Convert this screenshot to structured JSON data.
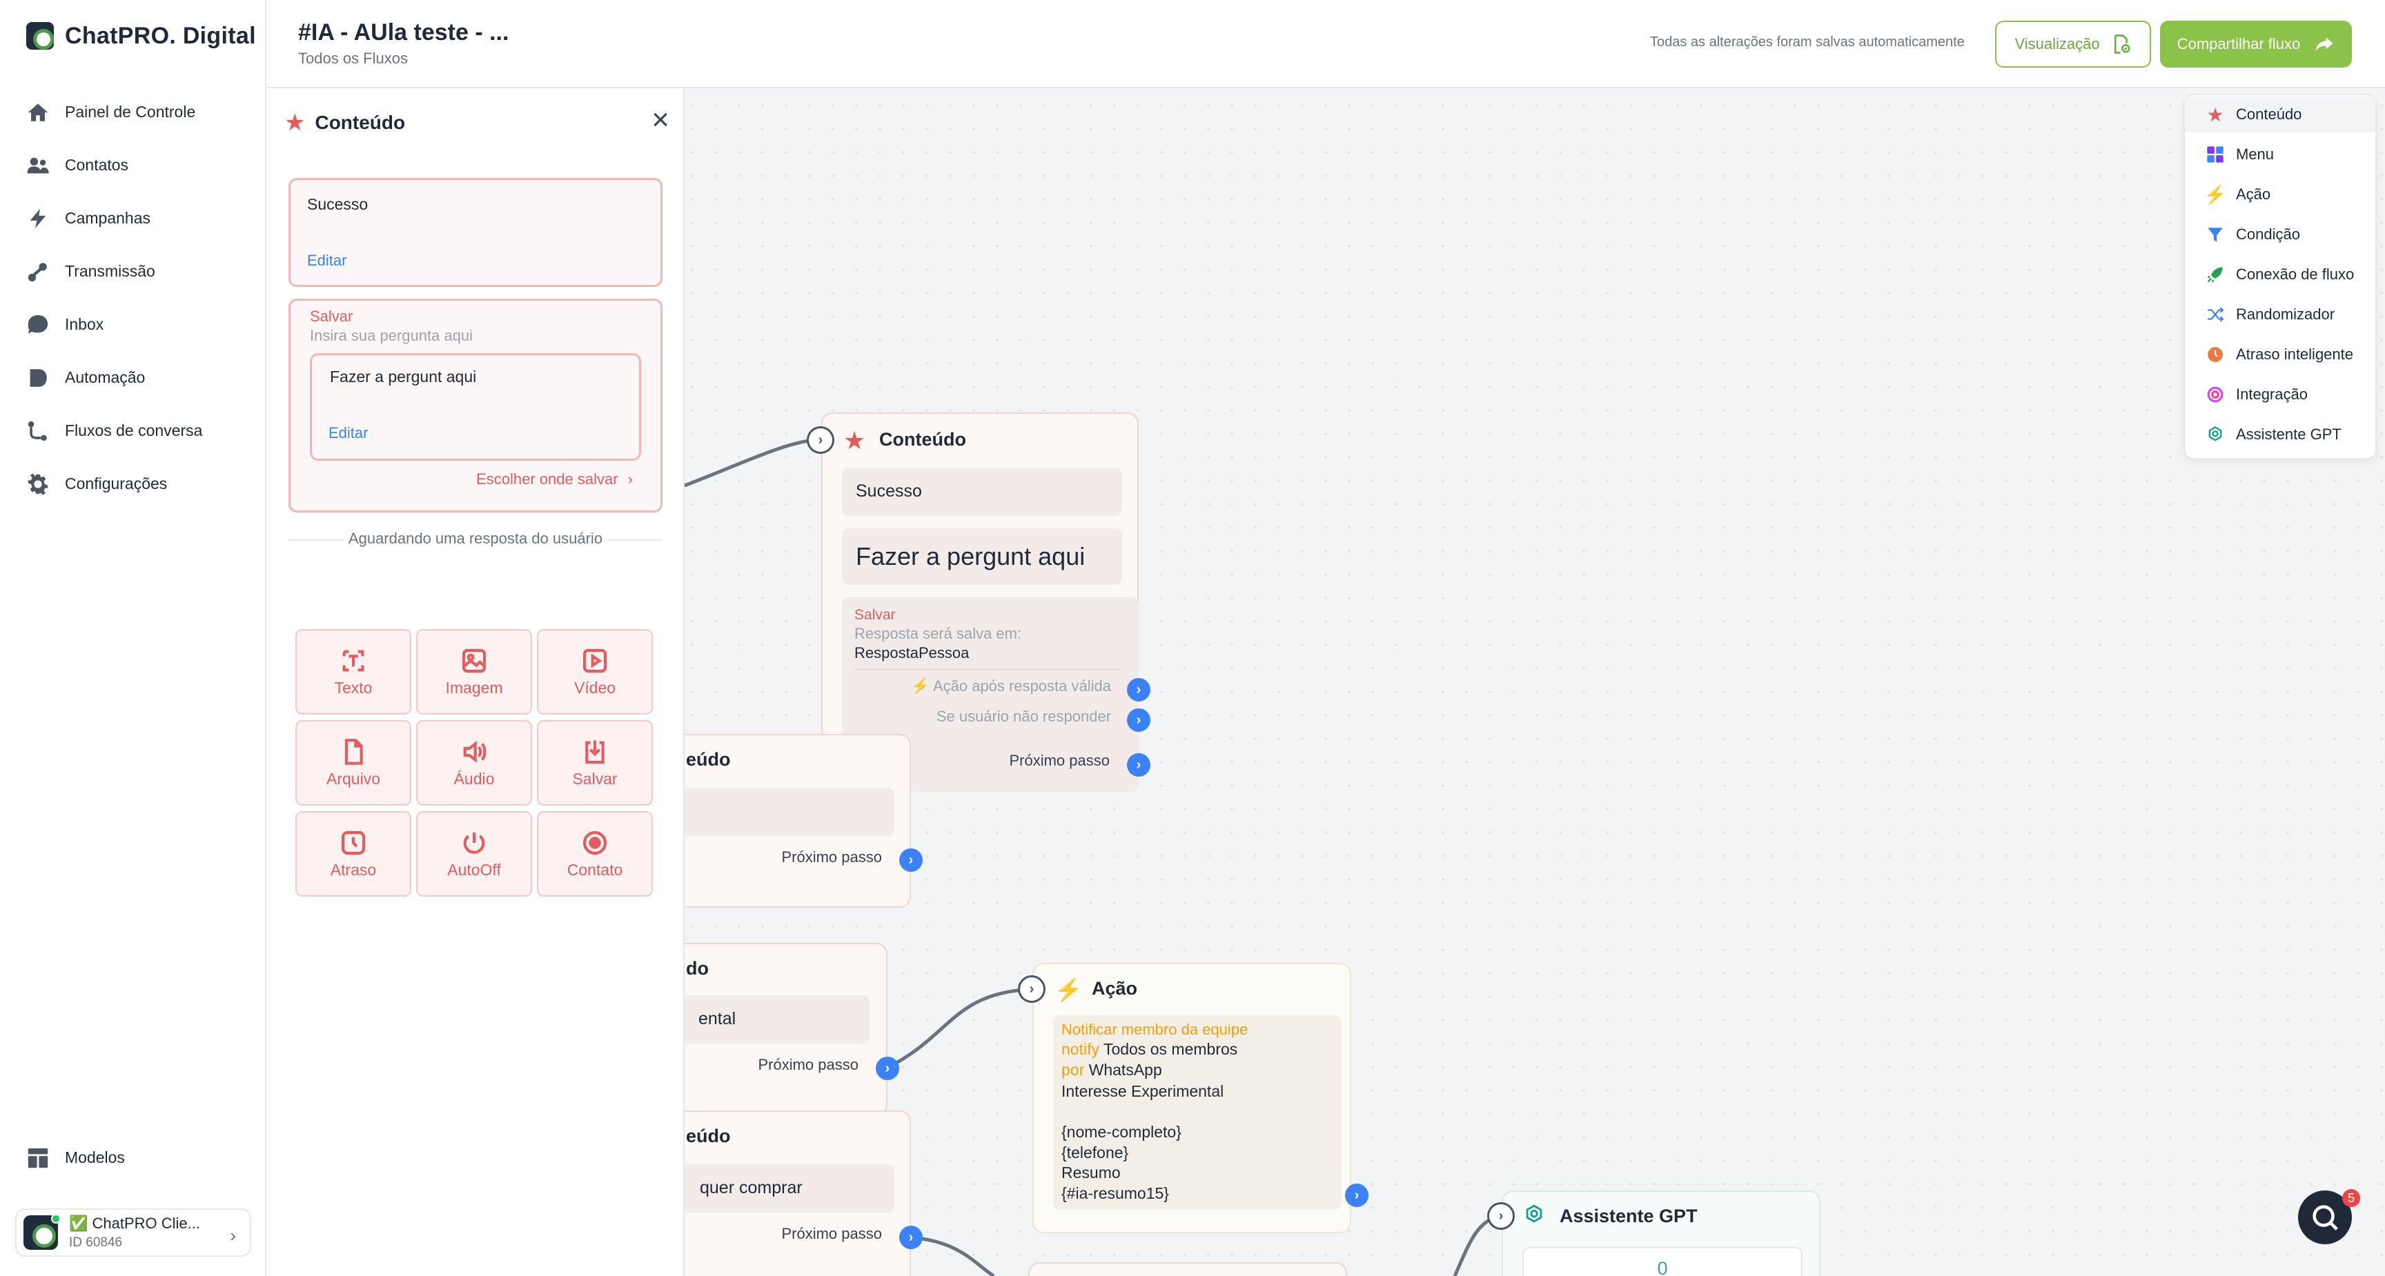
{
  "brand": {
    "name": "ChatPRO. Digital"
  },
  "sidebar": {
    "items": [
      {
        "label": "Painel de Controle",
        "icon": "home-icon"
      },
      {
        "label": "Contatos",
        "icon": "users-icon"
      },
      {
        "label": "Campanhas",
        "icon": "bolt-icon"
      },
      {
        "label": "Transmissão",
        "icon": "broadcast-icon"
      },
      {
        "label": "Inbox",
        "icon": "chat-icon"
      },
      {
        "label": "Automação",
        "icon": "automation-icon"
      },
      {
        "label": "Fluxos de conversa",
        "icon": "flow-icon"
      },
      {
        "label": "Configurações",
        "icon": "gear-icon"
      }
    ],
    "bottom": {
      "label": "Modelos",
      "icon": "templates-icon"
    },
    "account": {
      "name": "✅ ChatPRO Clie...",
      "id": "ID 60846"
    }
  },
  "header": {
    "title": "#IA - AUla teste - ...",
    "breadcrumb": "Todos os Fluxos",
    "autosave": "Todas as alterações foram salvas automaticamente",
    "preview_label": "Visualização",
    "share_label": "Compartilhar fluxo"
  },
  "editor": {
    "title": "Conteúdo",
    "message_text": "Sucesso",
    "edit_label": "Editar",
    "save_label": "Salvar",
    "question_placeholder": "Insira sua pergunta aqui",
    "question_text": "Fazer a pergunt aqui",
    "choose_save": "Escolher onde salvar",
    "waiting": "Aguardando uma resposta do usuário",
    "tiles": [
      "Texto",
      "Imagem",
      "Vídeo",
      "Arquivo",
      "Áudio",
      "Salvar",
      "Atraso",
      "AutoOff",
      "Contato"
    ]
  },
  "nodes": {
    "main": {
      "title": "Conteúdo",
      "msg1": "Sucesso",
      "msg2": "Fazer a pergunt aqui",
      "save_label": "Salvar",
      "save_desc": "Resposta será salva em:",
      "save_var": "RespostaPessoa",
      "valid_action": "Ação após resposta válida",
      "no_reply": "Se usuário não responder",
      "next": "Próximo passo"
    },
    "node2": {
      "title": "eúdo",
      "next": "Próximo passo"
    },
    "node3": {
      "title": "do",
      "text": "ental",
      "next": "Próximo passo"
    },
    "node4": {
      "title": "eúdo",
      "text": "quer comprar",
      "next": "Próximo passo"
    },
    "action": {
      "title": "Ação",
      "notify_title": "Notificar membro da equipe",
      "notify_kw": "notify",
      "notify_who": "Todos os membros",
      "via_kw": "por",
      "via": "WhatsApp",
      "lines": [
        "Interesse Experimental",
        "",
        "{nome-completo}",
        "{telefone}",
        "Resumo",
        "{#ia-resumo15}"
      ]
    },
    "gpt": {
      "title": "Assistente GPT",
      "value": "0"
    }
  },
  "palette": {
    "items": [
      {
        "label": "Conteúdo",
        "icon": "star-icon",
        "color": "#e35d5d"
      },
      {
        "label": "Menu",
        "icon": "grid-icon",
        "color": "#7c3aed"
      },
      {
        "label": "Ação",
        "icon": "bolt-icon",
        "color": "#f59e0b"
      },
      {
        "label": "Condição",
        "icon": "filter-icon",
        "color": "#3b82f6"
      },
      {
        "label": "Conexão de fluxo",
        "icon": "rocket-icon",
        "color": "#22a04b"
      },
      {
        "label": "Randomizador",
        "icon": "shuffle-icon",
        "color": "#3b82f6"
      },
      {
        "label": "Atraso inteligente",
        "icon": "clock-icon",
        "color": "#ea7b3c"
      },
      {
        "label": "Integração",
        "icon": "integration-icon",
        "color": "#d946ef"
      },
      {
        "label": "Assistente GPT",
        "icon": "openai-icon",
        "color": "#10a37f"
      }
    ]
  },
  "help": {
    "badge": "5"
  },
  "colors": {
    "accent": "#8bc34a",
    "content": "#e35d5d",
    "link": "#3b82f6"
  }
}
